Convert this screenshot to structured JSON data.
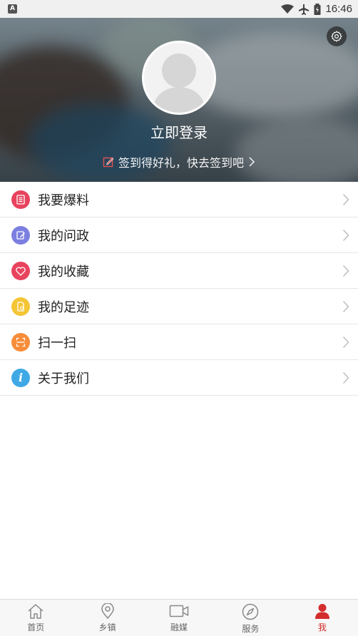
{
  "status_bar": {
    "time": "16:46",
    "left_badge": "A"
  },
  "header": {
    "login_text": "立即登录",
    "signin_text": "签到得好礼，快去签到吧"
  },
  "menu": [
    {
      "label": "我要爆料",
      "icon": "report-icon",
      "color": "#e8435e"
    },
    {
      "label": "我的问政",
      "icon": "inquiry-icon",
      "color": "#7b7fe0"
    },
    {
      "label": "我的收藏",
      "icon": "heart-icon",
      "color": "#e8435e"
    },
    {
      "label": "我的足迹",
      "icon": "footprint-icon",
      "color": "#f4c534"
    },
    {
      "label": "扫一扫",
      "icon": "scan-icon",
      "color": "#f78d3a"
    },
    {
      "label": "关于我们",
      "icon": "info-icon",
      "color": "#3fa9e6"
    }
  ],
  "tabs": [
    {
      "label": "首页",
      "icon": "home-icon"
    },
    {
      "label": "乡镇",
      "icon": "location-icon"
    },
    {
      "label": "融媒",
      "icon": "video-icon"
    },
    {
      "label": "服务",
      "icon": "compass-icon"
    },
    {
      "label": "我",
      "icon": "person-icon",
      "active": true
    }
  ],
  "colors": {
    "accent": "#d42d2d"
  }
}
